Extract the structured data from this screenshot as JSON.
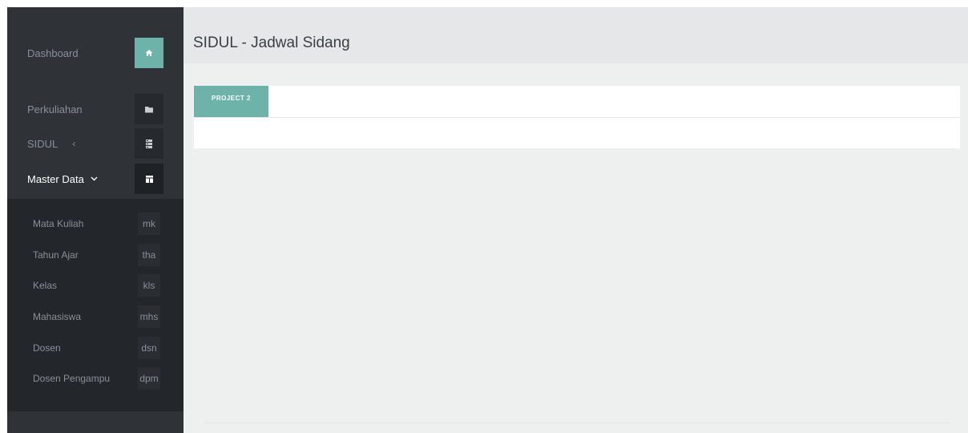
{
  "sidebar": {
    "items": [
      {
        "label": "Dashboard",
        "icon": "home-icon"
      },
      {
        "label": "Perkuliahan",
        "icon": "folder-icon"
      },
      {
        "label": "SIDUL",
        "caret": "‹",
        "icon": "server-icon"
      },
      {
        "label": "Master Data",
        "caret": "⌄",
        "icon": "layout-icon"
      }
    ],
    "submenu": [
      {
        "label": "Mata Kuliah",
        "abbr": "mk"
      },
      {
        "label": "Tahun Ajar",
        "abbr": "tha"
      },
      {
        "label": "Kelas",
        "abbr": "kls"
      },
      {
        "label": "Mahasiswa",
        "abbr": "mhs"
      },
      {
        "label": "Dosen",
        "abbr": "dsn"
      },
      {
        "label": "Dosen Pengampu",
        "abbr": "dpm"
      }
    ]
  },
  "header": {
    "title": "SIDUL - Jadwal Sidang"
  },
  "panel": {
    "tab_label": "PROJECT 2"
  },
  "colors": {
    "accent": "#6db3a9",
    "sidebar_bg": "#2f3338",
    "submenu_bg": "#23262a",
    "content_bg": "#eeefef"
  }
}
